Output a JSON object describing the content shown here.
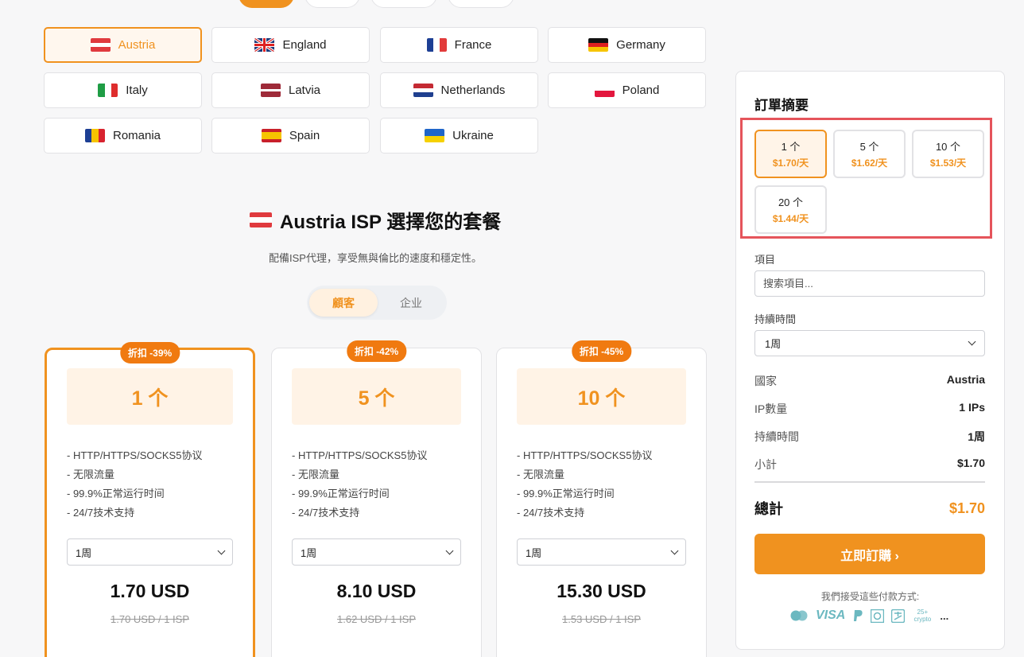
{
  "countries": [
    {
      "name": "Austria",
      "active": true
    },
    {
      "name": "England"
    },
    {
      "name": "France"
    },
    {
      "name": "Germany"
    },
    {
      "name": "Italy"
    },
    {
      "name": "Latvia"
    },
    {
      "name": "Netherlands"
    },
    {
      "name": "Poland"
    },
    {
      "name": "Romania"
    },
    {
      "name": "Spain"
    },
    {
      "name": "Ukraine"
    }
  ],
  "heading": {
    "title": "Austria ISP 選擇您的套餐",
    "subtitle": "配備ISP代理，享受無與倫比的速度和穩定性。"
  },
  "segment": {
    "consumer": "顧客",
    "enterprise": "企业"
  },
  "plans": [
    {
      "badge": "折扣 -39%",
      "qty": "1 个",
      "features": [
        "- HTTP/HTTPS/SOCKS5协议",
        "- 无限流量",
        "- 99.9%正常运行时间",
        "- 24/7技术支持"
      ],
      "duration": "1周",
      "price": "1.70 USD",
      "original": "1.70 USD / 1 ISP"
    },
    {
      "badge": "折扣 -42%",
      "qty": "5 个",
      "features": [
        "- HTTP/HTTPS/SOCKS5协议",
        "- 无限流量",
        "- 99.9%正常运行时间",
        "- 24/7技术支持"
      ],
      "duration": "1周",
      "price": "8.10 USD",
      "original": "1.62 USD / 1 ISP"
    },
    {
      "badge": "折扣 -45%",
      "qty": "10 个",
      "features": [
        "- HTTP/HTTPS/SOCKS5协议",
        "- 无限流量",
        "- 99.9%正常运行时间",
        "- 24/7技术支持"
      ],
      "duration": "1周",
      "price": "15.30 USD",
      "original": "1.53 USD / 1 ISP"
    }
  ],
  "summary": {
    "title": "訂單摘要",
    "options": [
      {
        "qty": "1 个",
        "price": "$1.70/天"
      },
      {
        "qty": "5 个",
        "price": "$1.62/天"
      },
      {
        "qty": "10 个",
        "price": "$1.53/天"
      },
      {
        "qty": "20 个",
        "price": "$1.44/天"
      }
    ],
    "project_label": "項目",
    "project_placeholder": "搜索項目...",
    "duration_label": "持續時間",
    "duration_value": "1周",
    "rows": [
      {
        "key": "國家",
        "value": "Austria"
      },
      {
        "key": "IP數量",
        "value": "1 IPs"
      },
      {
        "key": "持續時間",
        "value": "1周"
      },
      {
        "key": "小計",
        "value": "$1.70"
      }
    ],
    "total_label": "總計",
    "total_value": "$1.70",
    "order_button": "立即訂購 ›",
    "payment_text": "我們接受這些付款方式:",
    "payment_methods": [
      "mastercard-icon",
      "VISA",
      "paypal-icon",
      "wechat-icon",
      "alipay-icon",
      "25+ crypto",
      "..."
    ]
  },
  "colors": {
    "accent": "#f0921f",
    "highlight_border": "#e5545b"
  }
}
